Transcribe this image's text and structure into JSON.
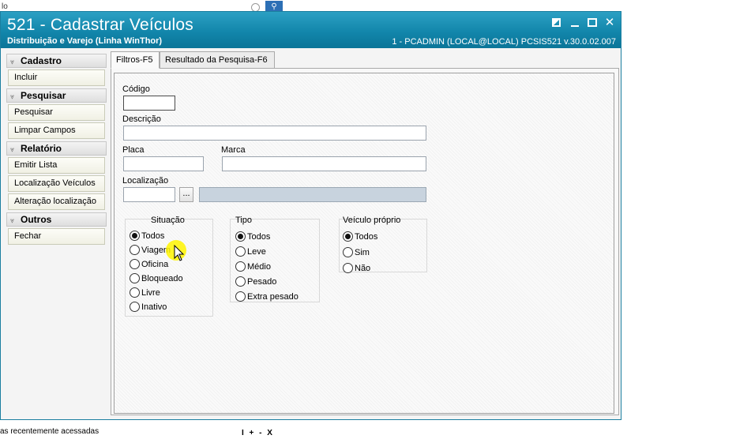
{
  "background": {
    "top_text": "lo",
    "bottom_text": "as recentemente acessadas",
    "bottom_controls": "I + - X"
  },
  "window": {
    "title": "521 - Cadastrar Veículos",
    "subtitle": "Distribuição e Varejo (Linha WinThor)",
    "status": "1 - PCADMIN (LOCAL@LOCAL)   PCSIS521   v.30.0.02.007",
    "controls": {
      "close": "✕"
    }
  },
  "sidebar": {
    "groups": [
      {
        "label": "Cadastro",
        "items": [
          "Incluir"
        ]
      },
      {
        "label": "Pesquisar",
        "items": [
          "Pesquisar",
          "Limpar Campos"
        ]
      },
      {
        "label": "Relatório",
        "items": [
          "Emitir Lista",
          "Localização Veículos",
          "Alteração localização"
        ]
      },
      {
        "label": "Outros",
        "items": [
          "Fechar"
        ]
      }
    ]
  },
  "tabs": [
    {
      "label": "Filtros-F5",
      "active": true
    },
    {
      "label": "Resultado da Pesquisa-F6",
      "active": false
    }
  ],
  "form": {
    "codigo": {
      "label": "Código",
      "value": ""
    },
    "descricao": {
      "label": "Descrição",
      "value": ""
    },
    "placa": {
      "label": "Placa",
      "value": ""
    },
    "marca": {
      "label": "Marca",
      "value": ""
    },
    "localizacao": {
      "label": "Localização",
      "value": "",
      "button": "...",
      "description": ""
    }
  },
  "situacao": {
    "title": "Situação",
    "options": [
      "Todos",
      "Viagem",
      "Oficina",
      "Bloqueado",
      "Livre",
      "Inativo"
    ],
    "selected": "Todos"
  },
  "tipo": {
    "title": "Tipo",
    "options": [
      "Todos",
      "Leve",
      "Médio",
      "Pesado",
      "Extra pesado"
    ],
    "selected": "Todos"
  },
  "veiculo_proprio": {
    "title": "Veículo próprio",
    "options": [
      "Todos",
      "Sim",
      "Não"
    ],
    "selected": "Todos"
  },
  "colors": {
    "titlebar": "#1286ab",
    "border": "#1b7fa0",
    "cursor_highlight": "#fff500"
  }
}
